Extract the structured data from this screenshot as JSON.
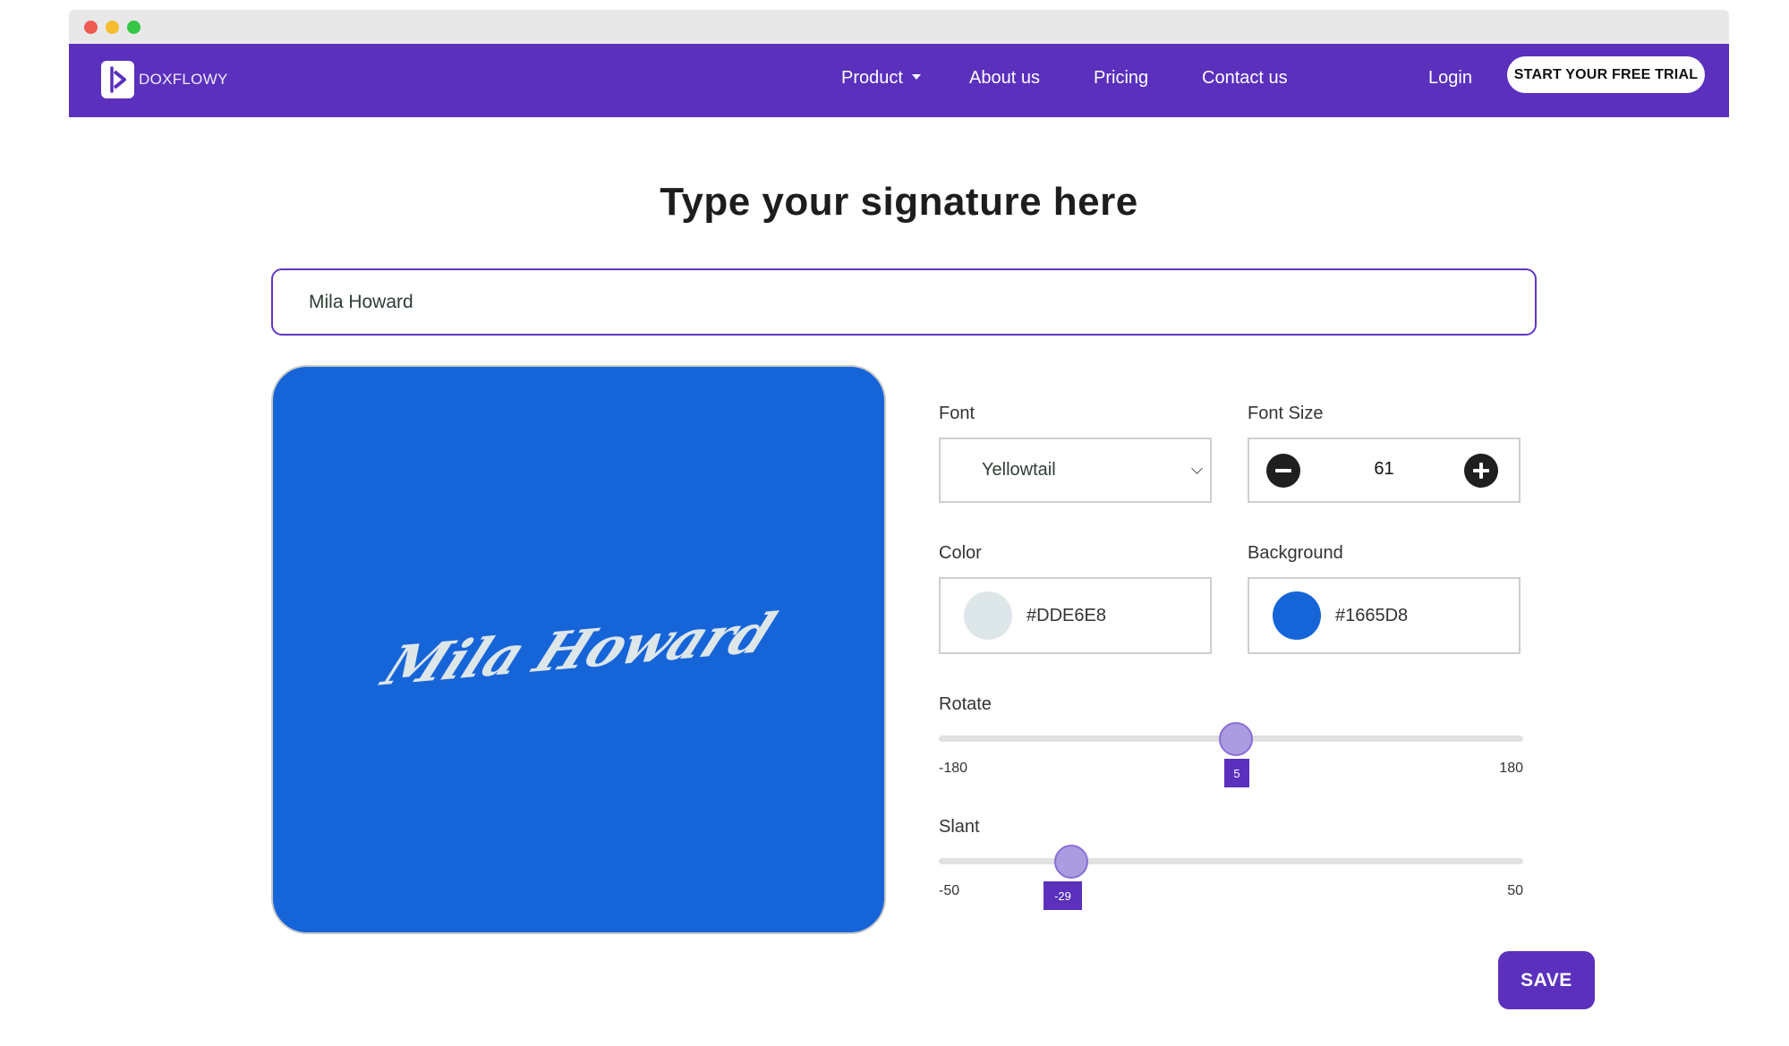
{
  "brand": {
    "name": "DOXFLOWY"
  },
  "nav": {
    "product": "Product",
    "about": "About us",
    "pricing": "Pricing",
    "contact": "Contact us",
    "login": "Login",
    "trial": "START YOUR FREE TRIAL"
  },
  "heading": "Type your signature here",
  "signature_input": {
    "value": "Mila Howard"
  },
  "preview": {
    "text": "Mila Howard"
  },
  "controls": {
    "font": {
      "label": "Font",
      "selected": "Yellowtail"
    },
    "font_size": {
      "label": "Font Size",
      "value": "61"
    },
    "color": {
      "label": "Color",
      "value": "#DDE6E8",
      "swatch": "#dde6e8"
    },
    "background": {
      "label": "Background",
      "value": "#1665D8",
      "swatch": "#1665d8"
    },
    "rotate": {
      "label": "Rotate",
      "min": "-180",
      "max": "180",
      "value": "5"
    },
    "slant": {
      "label": "Slant",
      "min": "-50",
      "max": "50",
      "value": "-29"
    }
  },
  "save_label": "SAVE",
  "colors": {
    "accent": "#5a30bd",
    "preview_bg": "#1665d8",
    "signature_color": "#dde6e8"
  }
}
